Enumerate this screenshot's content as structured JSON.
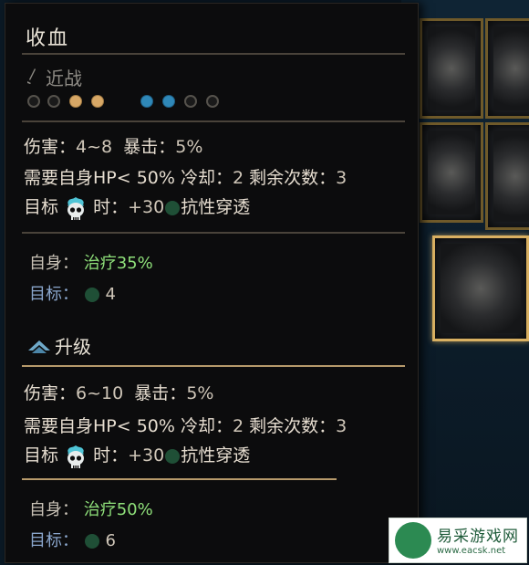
{
  "skill": {
    "name": "收血",
    "type": "近战",
    "ranks": [
      "empty",
      "empty",
      "gold",
      "gold"
    ],
    "targets": [
      "blue",
      "blue",
      "empty",
      "empty"
    ]
  },
  "base": {
    "damage_label": "伤害：",
    "damage_value": "4~8",
    "crit_label": "暴击：",
    "crit_value": "5%",
    "req_label": "需要自身HP< 50%",
    "cooldown_label": "冷却：",
    "cooldown_value": "2",
    "uses_label": "剩余次数：",
    "uses_value": "3",
    "target_label": "目标",
    "when_label": "时：",
    "resist_value": "+30",
    "resist_label": "抗性穿透",
    "self_label": "自身：",
    "self_value": "治疗35%",
    "target2_label": "目标：",
    "blight_value": "4"
  },
  "upgrade": {
    "title": "升级",
    "damage_label": "伤害：",
    "damage_value": "6~10",
    "crit_label": "暴击：",
    "crit_value": "5%",
    "req_label": "需要自身HP< 50%",
    "cooldown_label": "冷却：",
    "cooldown_value": "2",
    "uses_label": "剩余次数：",
    "uses_value": "3",
    "target_label": "目标",
    "when_label": "时：",
    "resist_value": "+30",
    "resist_label": "抗性穿透",
    "self_label": "自身：",
    "self_value": "治疗50%",
    "target2_label": "目标：",
    "blight_value": "6"
  },
  "watermark": {
    "name": "易采游戏网",
    "url": "www.eacsk.net"
  },
  "colors": {
    "panel_bg": "#0c0c0d",
    "heal": "#8fe07a",
    "target": "#8aa6cc",
    "rank_gold": "#d8a866",
    "target_blue": "#2f88b8"
  }
}
